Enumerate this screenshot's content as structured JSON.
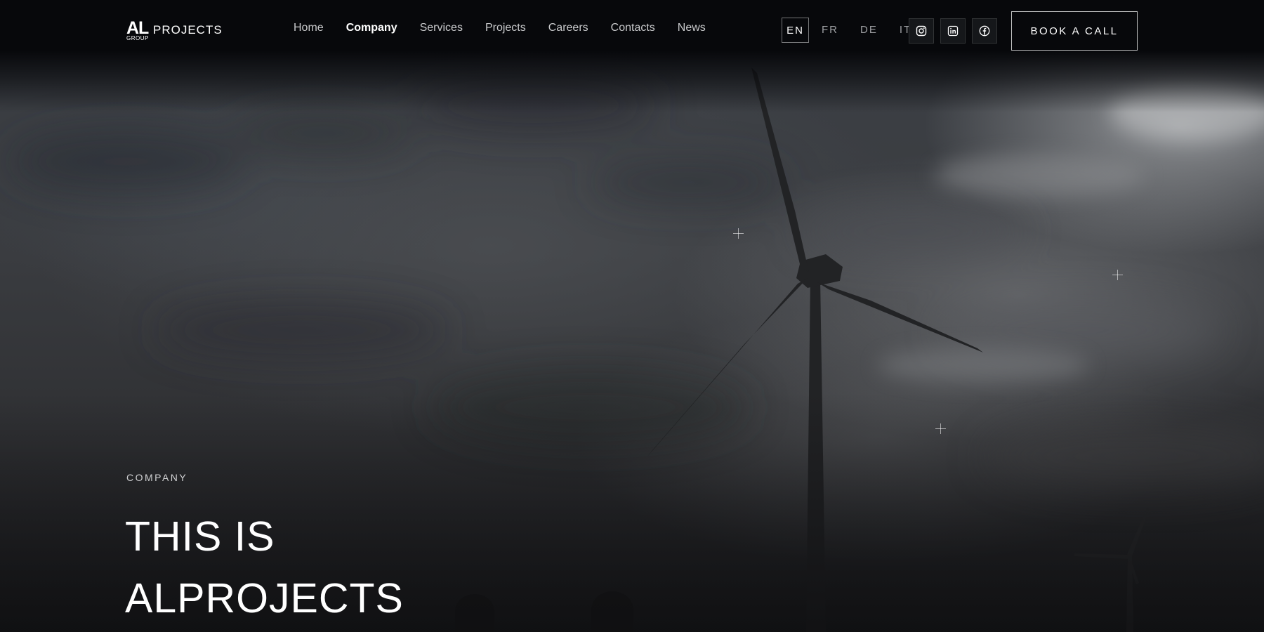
{
  "brand": {
    "logo_mark": "AL",
    "logo_word": "PROJECTS",
    "logo_sub": "GROUP"
  },
  "nav": {
    "items": [
      {
        "label": "Home",
        "active": false
      },
      {
        "label": "Company",
        "active": true
      },
      {
        "label": "Services",
        "active": false
      },
      {
        "label": "Projects",
        "active": false
      },
      {
        "label": "Careers",
        "active": false
      },
      {
        "label": "Contacts",
        "active": false
      },
      {
        "label": "News",
        "active": false
      }
    ]
  },
  "languages": {
    "items": [
      {
        "label": "EN",
        "active": true
      },
      {
        "label": "FR",
        "active": false
      },
      {
        "label": "DE",
        "active": false
      },
      {
        "label": "IT",
        "active": false
      }
    ]
  },
  "social": {
    "items": [
      {
        "icon": "instagram-icon"
      },
      {
        "icon": "linkedin-icon"
      },
      {
        "icon": "facebook-icon"
      }
    ]
  },
  "cta": {
    "book_label": "BOOK A CALL"
  },
  "hero": {
    "eyebrow": "COMPANY",
    "headline_line1": "THIS IS",
    "headline_line2": "ALPROJECTS"
  },
  "colors": {
    "header_bg": "#07080b",
    "text": "#ffffff",
    "nav_inactive": "#c9cacc",
    "lang_inactive": "#9ea0a3"
  }
}
